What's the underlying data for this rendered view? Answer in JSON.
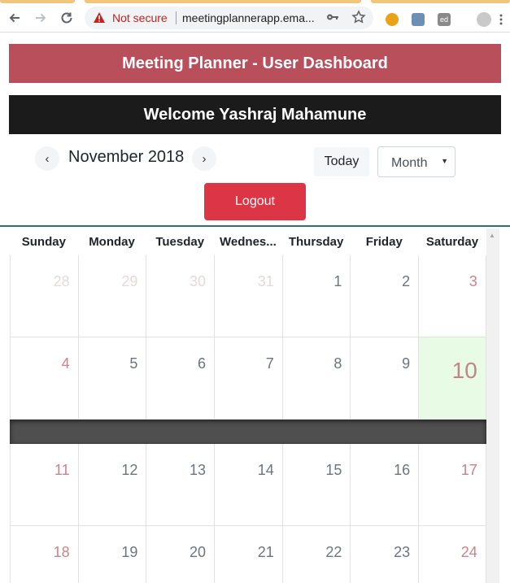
{
  "browser": {
    "security_label": "Not secure",
    "url": "meetingplannerapp.ema...",
    "extensions": [
      {
        "name": "extension-1",
        "color": "#e8a317"
      },
      {
        "name": "extension-2",
        "color": "#6d8fb5"
      },
      {
        "name": "extension-ed",
        "color": "#8a8a8a",
        "label": "ed"
      },
      {
        "name": "profile",
        "color": "#c9c9c9"
      }
    ]
  },
  "header": {
    "title": "Meeting Planner - User Dashboard",
    "welcome": "Welcome Yashraj Mahamune"
  },
  "toolbar": {
    "prev_label": "‹",
    "next_label": "›",
    "month_title": "November 2018",
    "today_label": "Today",
    "view_selected": "Month",
    "logout_label": "Logout"
  },
  "calendar": {
    "weekdays": [
      "Sunday",
      "Monday",
      "Tuesday",
      "Wednes...",
      "Thursday",
      "Friday",
      "Saturday"
    ],
    "weeks": [
      [
        "28",
        "29",
        "30",
        "31",
        "1",
        "2",
        "3"
      ],
      [
        "4",
        "5",
        "6",
        "7",
        "8",
        "9",
        "10"
      ],
      [
        "11",
        "12",
        "13",
        "14",
        "15",
        "16",
        "17"
      ],
      [
        "18",
        "19",
        "20",
        "21",
        "22",
        "23",
        "24"
      ]
    ],
    "today": "10",
    "colors": {
      "banner": "#b84f5b",
      "welcome_bar": "#1b1b1b",
      "logout": "#dc3545",
      "today_bg": "#e8fbe5",
      "weekend_text": "#c9848a"
    }
  }
}
